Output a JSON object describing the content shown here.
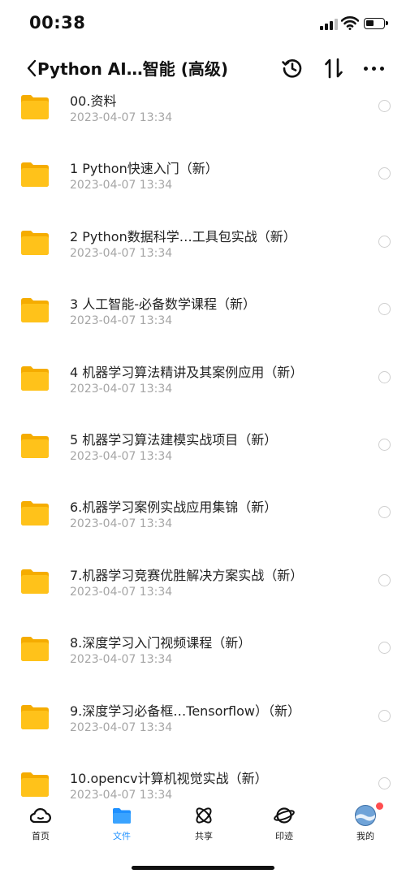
{
  "status_bar": {
    "time": "00:38"
  },
  "nav": {
    "title": "Python AI…智能 (高级)"
  },
  "files": [
    {
      "name": "00.资料",
      "date": "2023-04-07 13:34"
    },
    {
      "name": "1 Python快速入门（新）",
      "date": "2023-04-07 13:34"
    },
    {
      "name": "2 Python数据科学…工具包实战（新）",
      "date": "2023-04-07 13:34"
    },
    {
      "name": "3 人工智能-必备数学课程（新）",
      "date": "2023-04-07 13:34"
    },
    {
      "name": "4 机器学习算法精讲及其案例应用（新）",
      "date": "2023-04-07 13:34"
    },
    {
      "name": "5 机器学习算法建模实战项目（新）",
      "date": "2023-04-07 13:34"
    },
    {
      "name": "6.机器学习案例实战应用集锦（新）",
      "date": "2023-04-07 13:34"
    },
    {
      "name": "7.机器学习竞赛优胜解决方案实战（新）",
      "date": "2023-04-07 13:34"
    },
    {
      "name": "8.深度学习入门视频课程（新）",
      "date": "2023-04-07 13:34"
    },
    {
      "name": "9.深度学习必备框…Tensorflow）（新）",
      "date": "2023-04-07 13:34"
    },
    {
      "name": "10.opencv计算机视觉实战（新）",
      "date": "2023-04-07 13:34"
    }
  ],
  "tabs": [
    {
      "label": "首页",
      "icon": "cloud-home-icon",
      "active": false
    },
    {
      "label": "文件",
      "icon": "folder-tab-icon",
      "active": true
    },
    {
      "label": "共享",
      "icon": "share-atom-icon",
      "active": false
    },
    {
      "label": "印迹",
      "icon": "planet-icon",
      "active": false
    },
    {
      "label": "我的",
      "icon": "avatar-icon",
      "active": false,
      "badge": true
    }
  ],
  "colors": {
    "accent": "#1e90ff",
    "folder": "#ffc21a",
    "badge": "#ff4d4f",
    "meta_text": "#a5a5a5"
  }
}
